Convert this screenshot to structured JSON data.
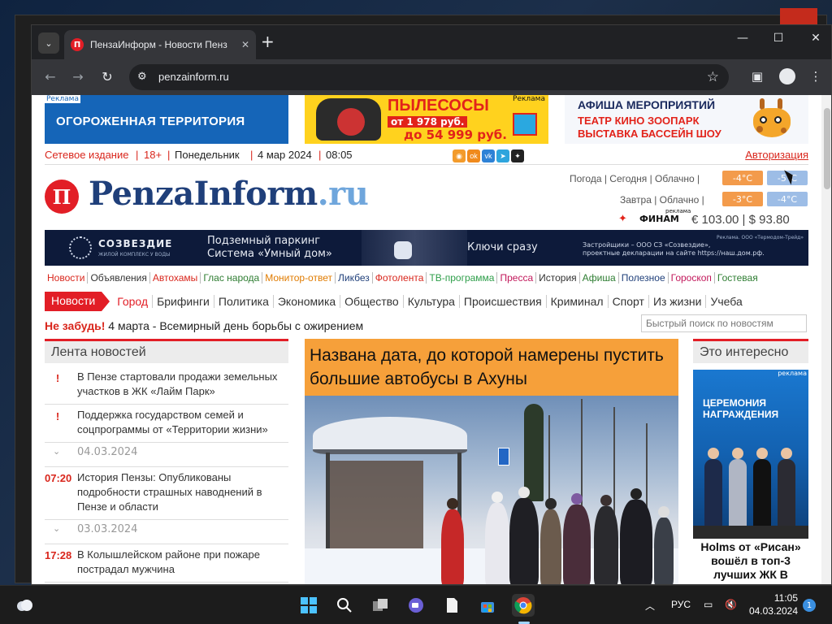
{
  "browser": {
    "tab_title": "ПензаИнформ - Новости Пенз",
    "url": "penzainform.ru",
    "tab_search_icon": "chevron-down-icon",
    "new_tab_symbol": "+",
    "minimize": "—",
    "maximize": "☐",
    "close": "✕"
  },
  "ads": {
    "left_tag": "Реклама",
    "left_text": "ОГОРОЖЕННАЯ ТЕРРИТОРИЯ",
    "mid_title": "ПЫЛЕСОСЫ",
    "mid_price_from": "от 1 978 руб.",
    "mid_price_to": "до 54 999 руб.",
    "mid_tag": "Реклама",
    "right_title": "АФИША МЕРОПРИЯТИЙ",
    "right_line1": "ТЕАТР КИНО ЗООПАРК",
    "right_line2": "ВЫСТАВКА БАССЕЙН ШОУ"
  },
  "meta": {
    "edition": "Сетевое издание",
    "age": "18+",
    "weekday": "Понедельник",
    "date": "4 мар 2024",
    "time": "08:05",
    "auth": "Авторизация"
  },
  "logo": {
    "mark": "П",
    "name": "PenzaInform",
    "tld": ".ru"
  },
  "weather": {
    "today_label": "Погода  |  Сегодня  |  Облачно  |",
    "today_day": "-4°C",
    "today_night": "-5°C",
    "tomorrow_label": "Завтра  |  Облачно  |",
    "tomorrow_day": "-3°C",
    "tomorrow_night": "-4°C"
  },
  "rates": {
    "sponsor": "ФИНАМ",
    "sponsor_tag": "реклама",
    "text": "€  103.00   |   $  93.80"
  },
  "banner": {
    "brand": "СОЗВЕЗДИЕ",
    "brand_sub": "ЖИЛОЙ КОМПЛЕКС У ВОДЫ",
    "line1": "Подземный паркинг",
    "line2": "Система «Умный дом»",
    "keys": "Ключи сразу",
    "dev_line1": "Застройщики – ООО СЗ «Созвездие»,",
    "dev_line2": "проектные декларации на сайте https://наш.дом.рф.",
    "ad_note": "Реклама. ООО «Термодом-Трейд»"
  },
  "rubrics": [
    {
      "label": "Новости",
      "color": "#d9261c"
    },
    {
      "label": "Объявления",
      "color": "#333333"
    },
    {
      "label": "Автохамы",
      "color": "#d9261c"
    },
    {
      "label": "Глас народа",
      "color": "#2e7d32"
    },
    {
      "label": "Монитор-ответ",
      "color": "#e07b00"
    },
    {
      "label": "Ликбез",
      "color": "#1f3f7a"
    },
    {
      "label": "Фотолента",
      "color": "#d9261c"
    },
    {
      "label": "ТВ-программа",
      "color": "#2e9e4a"
    },
    {
      "label": "Пресса",
      "color": "#c2185b"
    },
    {
      "label": "История",
      "color": "#333333"
    },
    {
      "label": "Афиша",
      "color": "#2e7d32"
    },
    {
      "label": "Полезное",
      "color": "#1f3f7a"
    },
    {
      "label": "Гороскоп",
      "color": "#c2185b"
    },
    {
      "label": "Гостевая",
      "color": "#2e7d32"
    }
  ],
  "mainnav": {
    "active": "Новости",
    "items": [
      "Город",
      "Брифинги",
      "Политика",
      "Экономика",
      "Общество",
      "Культура",
      "Происшествия",
      "Криминал",
      "Спорт",
      "Из жизни",
      "Учеба"
    ]
  },
  "reminder": {
    "label": "Не забудь!",
    "text": " 4 марта - Всемирный день борьбы с ожирением"
  },
  "search": {
    "placeholder": "Быстрый поиск по новостям"
  },
  "feed": {
    "title": "Лента новостей",
    "rows": [
      {
        "type": "item",
        "mark": "!",
        "text": "В Пензе стартовали продажи земельных участков в ЖК «Лайм Парк»"
      },
      {
        "type": "item",
        "mark": "!",
        "text": "Поддержка государством семей и соцпрограммы от «Территории жизни»"
      },
      {
        "type": "date",
        "text": "04.03.2024"
      },
      {
        "type": "item",
        "mark": "07:20",
        "text": "История Пензы: Опубликованы подробности страшных наводнений в Пензе и области"
      },
      {
        "type": "date",
        "text": "03.03.2024"
      },
      {
        "type": "item",
        "mark": "17:28",
        "text": "В Колышлейском районе при пожаре пострадал мужчина"
      }
    ]
  },
  "lead": {
    "title": "Названа дата, до которой намерены пустить большие автобусы в Ахуны"
  },
  "side": {
    "title": "Это интересно",
    "img_text": "ЦЕРЕМОНИЯ НАГРАЖДЕНИЯ",
    "img_tag": "реклама",
    "caption": "Holms от «Рисан» вошёл в топ-3 лучших ЖК В"
  },
  "taskbar": {
    "lang": "РУС",
    "time": "11:05",
    "date": "04.03.2024",
    "notifications": "1"
  },
  "colors": {
    "brand_red": "#e21e26",
    "logo_blue": "#1f3f7a",
    "lead_orange": "#f6a03a"
  }
}
